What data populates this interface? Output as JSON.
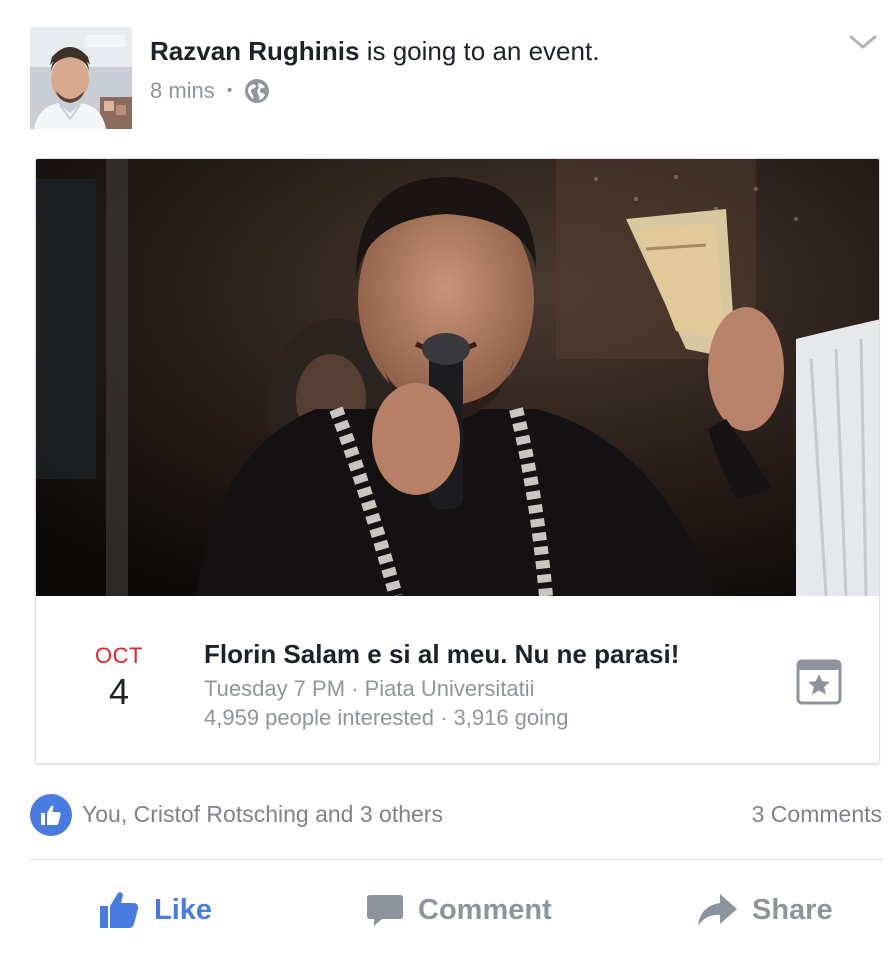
{
  "post": {
    "author": "Razvan Rughinis",
    "action": " is going to an event.",
    "time": "8 mins",
    "separator": "•",
    "privacy_icon": "globe-icon",
    "menu_icon": "chevron-down-icon"
  },
  "event": {
    "month": "OCT",
    "day": "4",
    "title": "Florin Salam e si al meu. Nu ne parasi!",
    "when_where": "Tuesday 7 PM · Piata Universitatii",
    "stats": "4,959 people interested · 3,916 going",
    "save_icon": "calendar-star-icon"
  },
  "reactions": {
    "icon": "thumbs-up-icon",
    "text": "You, Cristof Rotsching and 3 others",
    "comments": "3 Comments"
  },
  "actions": {
    "like": "Like",
    "comment": "Comment",
    "share": "Share"
  },
  "colors": {
    "accent": "#4a7be0",
    "date_red": "#e0252a",
    "muted": "#90949c",
    "text": "#1d2129"
  }
}
